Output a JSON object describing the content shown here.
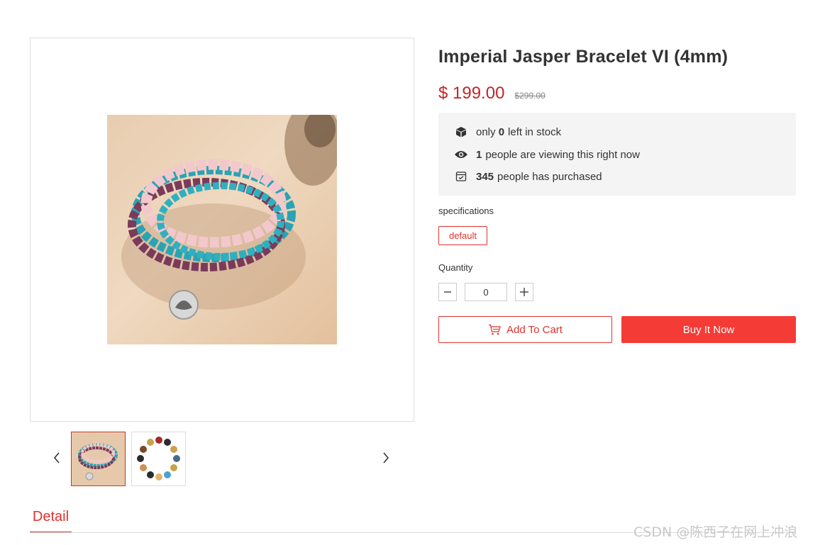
{
  "product": {
    "title": "Imperial Jasper Bracelet VI (4mm)",
    "price": "$ 199.00",
    "old_price": "$299.00"
  },
  "stock_info": {
    "stock_prefix": "only",
    "stock_count": "0",
    "stock_suffix": "left in stock",
    "viewers_count": "1",
    "viewers_suffix": "people are viewing this right now",
    "purchased_count": "345",
    "purchased_suffix": "people has purchased"
  },
  "specifications": {
    "label": "specifications",
    "options": [
      "default"
    ]
  },
  "quantity": {
    "label": "Quantity",
    "value": "0"
  },
  "buttons": {
    "add_to_cart": "Add To Cart",
    "buy_now": "Buy It Now"
  },
  "gallery": {
    "thumbnails": [
      "bracelet-stack",
      "bracelet-single"
    ],
    "active_index": 0
  },
  "tabs": {
    "detail": "Detail"
  },
  "watermark": "CSDN @陈西子在网上冲浪",
  "colors": {
    "accent": "#e0332f",
    "buy_bg": "#f53b35",
    "price": "#c0262a"
  },
  "icons": {
    "stock": "box-icon",
    "viewers": "eye-icon",
    "purchased": "receipt-icon",
    "cart": "cart-icon",
    "prev": "chevron-left-icon",
    "next": "chevron-right-icon"
  }
}
